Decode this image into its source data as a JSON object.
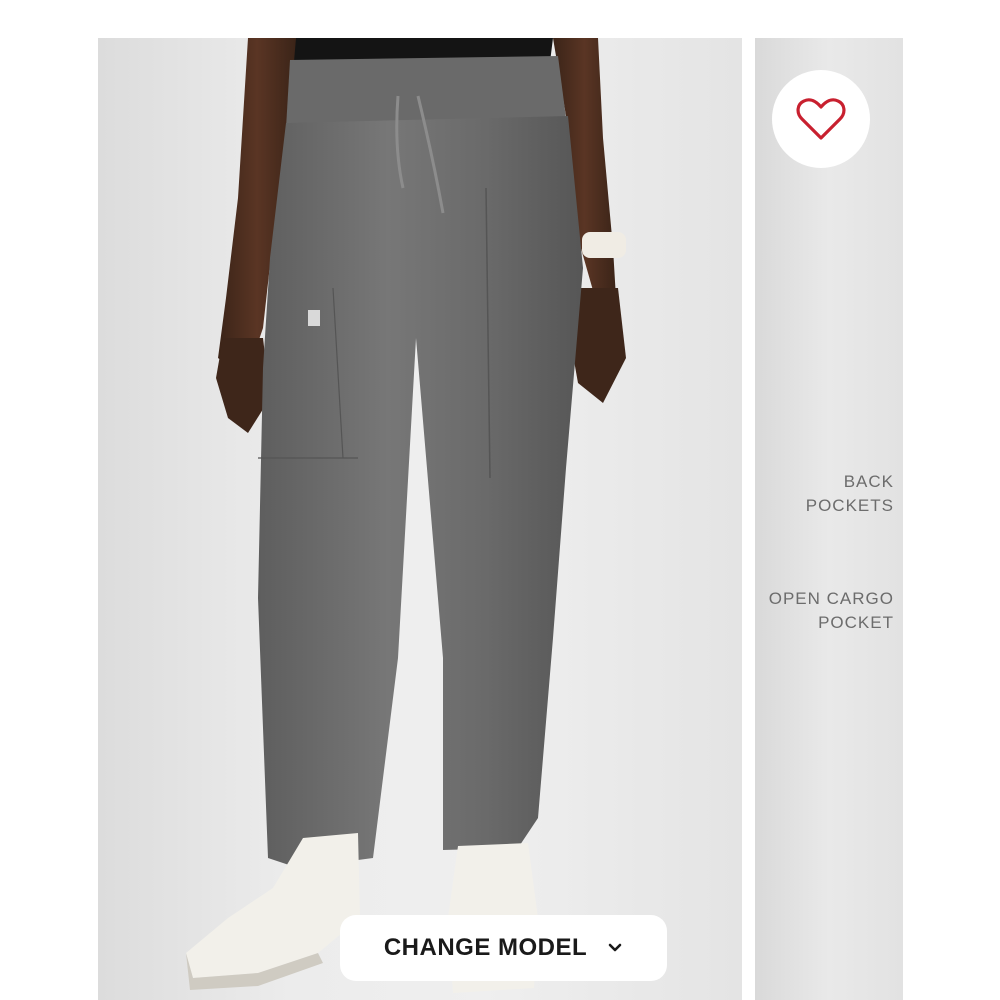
{
  "product_image": {
    "alt": "",
    "pant_color": "#6f6f6f",
    "background_color": "#e8e8e8"
  },
  "favorite": {
    "icon": "heart-outline-icon",
    "color": "#c8202f"
  },
  "features": {
    "back_pockets": [
      "BACK",
      "POCKETS"
    ],
    "open_cargo_pocket": [
      "OPEN CARGO",
      "POCKET"
    ]
  },
  "change_model": {
    "label": "CHANGE MODEL",
    "icon": "chevron-down-icon"
  }
}
